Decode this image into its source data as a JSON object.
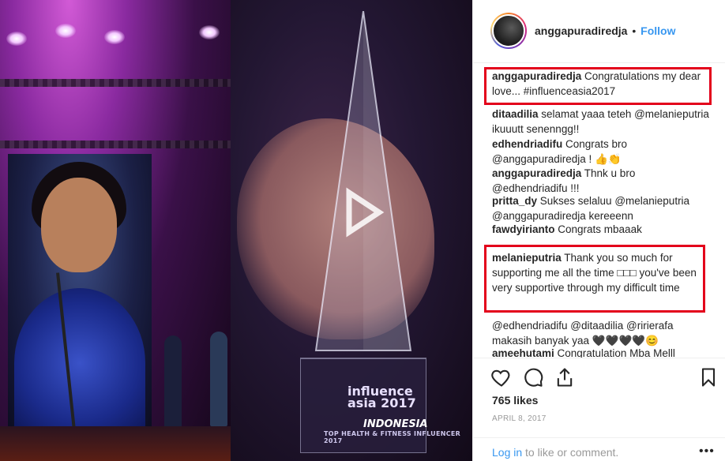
{
  "post": {
    "username": "anggapuradiredja",
    "separator": "•",
    "follow_label": "Follow",
    "likes": "765 likes",
    "date": "APRIL 8, 2017",
    "login_link": "Log in",
    "login_rest": " to like or comment.",
    "more": "•••"
  },
  "photo": {
    "award_line1": "influence",
    "award_line2": "asia 2017",
    "award_country": "INDONESIA",
    "award_category": "TOP HEALTH & FITNESS INFLUENCER 2017"
  },
  "comments": [
    {
      "user": "anggapuradiredja",
      "text": " Congratulations my dear love... #influenceasia2017"
    },
    {
      "user": "ditaadilia",
      "text": " selamat yaaa teteh @melanieputria ikuuutt senenngg!!"
    },
    {
      "user": "edhendriadifu",
      "text": " Congrats bro @anggapuradiredja ! 👍👏"
    },
    {
      "user": "anggapuradiredja",
      "text": " Thnk u bro @edhendriadifu !!!"
    },
    {
      "user": "pritta_dy",
      "text": " Sukses selaluu @melanieputria @anggapuradiredja kereeenn"
    },
    {
      "user": "fawdyirianto",
      "text": " Congrats mbaaak"
    },
    {
      "user": "melanieputria",
      "text": " Thank you so much for supporting me all the time □□□ you've been very supportive through my difficult time"
    },
    {
      "user": "",
      "text": "@edhendriadifu @ditaadilia @ririerafa makasih banyak yaa 🖤🖤🖤🖤😊"
    },
    {
      "user": "ameehutami",
      "text": " Congratulation Mba Melll"
    }
  ]
}
